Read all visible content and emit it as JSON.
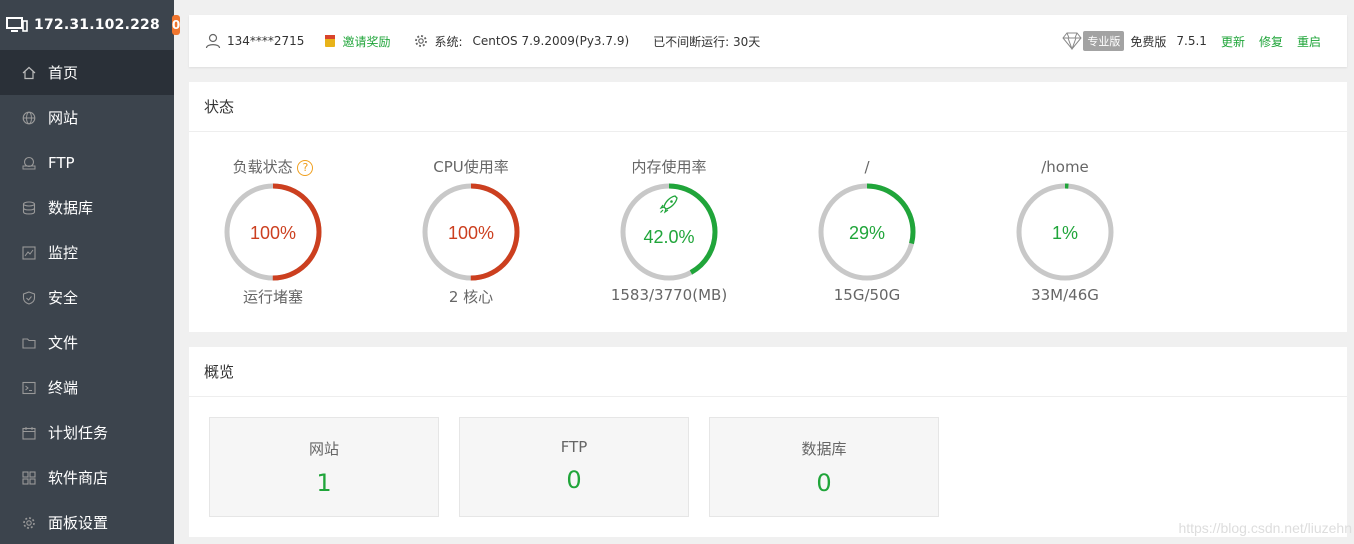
{
  "sidebar": {
    "ip": "172.31.102.228",
    "badge": "0",
    "items": [
      {
        "label": "首页",
        "icon": "home-icon"
      },
      {
        "label": "网站",
        "icon": "globe-icon"
      },
      {
        "label": "FTP",
        "icon": "ftp-icon"
      },
      {
        "label": "数据库",
        "icon": "database-icon"
      },
      {
        "label": "监控",
        "icon": "monitor-icon"
      },
      {
        "label": "安全",
        "icon": "shield-icon"
      },
      {
        "label": "文件",
        "icon": "folder-icon"
      },
      {
        "label": "终端",
        "icon": "terminal-icon"
      },
      {
        "label": "计划任务",
        "icon": "calendar-icon"
      },
      {
        "label": "软件商店",
        "icon": "apps-icon"
      },
      {
        "label": "面板设置",
        "icon": "gear-icon"
      }
    ]
  },
  "topbar": {
    "user": "134****2715",
    "invite": "邀请奖励",
    "system_label": "系统:",
    "system_value": "CentOS 7.9.2009(Py3.7.9)",
    "uptime": "已不间断运行: 30天",
    "pro_tag": "专业版",
    "edition": "免费版",
    "version": "7.5.1",
    "update": "更新",
    "repair": "修复",
    "restart": "重启"
  },
  "status": {
    "title": "状态",
    "gauges": [
      {
        "title": "负载状态",
        "value": "100%",
        "fraction": 1.0,
        "footer": "运行堵塞",
        "color": "#cc3f1f",
        "help": "?"
      },
      {
        "title": "CPU使用率",
        "value": "100%",
        "fraction": 1.0,
        "footer": "2 核心",
        "color": "#cc3f1f"
      },
      {
        "title": "内存使用率",
        "value": "42.0%",
        "fraction": 0.42,
        "footer": "1583/3770(MB)",
        "color": "#20a53a"
      },
      {
        "title": "/",
        "value": "29%",
        "fraction": 0.29,
        "footer": "15G/50G",
        "color": "#20a53a"
      },
      {
        "title": "/home",
        "value": "1%",
        "fraction": 0.01,
        "footer": "33M/46G",
        "color": "#20a53a"
      }
    ]
  },
  "overview": {
    "title": "概览",
    "boxes": [
      {
        "label": "网站",
        "value": "1"
      },
      {
        "label": "FTP",
        "value": "0"
      },
      {
        "label": "数据库",
        "value": "0"
      }
    ]
  },
  "watermark": "https://blog.csdn.net/liuzehn"
}
